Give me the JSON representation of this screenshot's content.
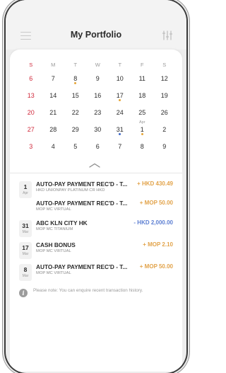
{
  "header": {
    "title": "My Portfolio",
    "menu_icon": "hamburger-menu-icon",
    "filter_icon": "filter-sliders-icon"
  },
  "calendar": {
    "weekdays": [
      "S",
      "M",
      "T",
      "W",
      "T",
      "F",
      "S"
    ],
    "weeks": [
      [
        {
          "d": "6"
        },
        {
          "d": "7"
        },
        {
          "d": "8",
          "dot": "orange"
        },
        {
          "d": "9"
        },
        {
          "d": "10"
        },
        {
          "d": "11"
        },
        {
          "d": "12"
        }
      ],
      [
        {
          "d": "13"
        },
        {
          "d": "14"
        },
        {
          "d": "15"
        },
        {
          "d": "16"
        },
        {
          "d": "17",
          "dot": "orange"
        },
        {
          "d": "18"
        },
        {
          "d": "19"
        }
      ],
      [
        {
          "d": "20"
        },
        {
          "d": "21"
        },
        {
          "d": "22"
        },
        {
          "d": "23"
        },
        {
          "d": "24"
        },
        {
          "d": "25"
        },
        {
          "d": "26"
        }
      ],
      [
        {
          "d": "27"
        },
        {
          "d": "28"
        },
        {
          "d": "29"
        },
        {
          "d": "30"
        },
        {
          "d": "31",
          "dot": "blue"
        },
        {
          "d": "1",
          "month": "Apr",
          "dot": "orange"
        },
        {
          "d": "2"
        }
      ],
      [
        {
          "d": "3"
        },
        {
          "d": "4"
        },
        {
          "d": "5"
        },
        {
          "d": "6"
        },
        {
          "d": "7"
        },
        {
          "d": "8"
        },
        {
          "d": "9"
        }
      ]
    ],
    "collapse_icon": "chevron-up-icon"
  },
  "transactions": [
    {
      "day": "1",
      "month": "Apr",
      "title": "AUTO-PAY PAYMENT REC'D - T...",
      "sub": "HKD UNIONPAY PLATINUM CR HKD",
      "amount": "+ HKD 430.49",
      "type": "pos"
    },
    {
      "day": "",
      "month": "",
      "title": "AUTO-PAY PAYMENT REC'D - T...",
      "sub": "MOP MC VIRTUAL",
      "amount": "+ MOP 50.00",
      "type": "pos"
    },
    {
      "day": "31",
      "month": "Mar",
      "title": "ABC KLN CITY HK",
      "sub": "MOP MC TITANIUM",
      "amount": "- HKD 2,000.00",
      "type": "neg"
    },
    {
      "day": "17",
      "month": "Mar",
      "title": "CASH BONUS",
      "sub": "MOP MC VIRTUAL",
      "amount": "+ MOP 2.10",
      "type": "pos"
    },
    {
      "day": "8",
      "month": "Mar",
      "title": "AUTO-PAY PAYMENT REC'D - T...",
      "sub": "MOP MC VIRTUAL",
      "amount": "+ MOP 50.00",
      "type": "pos"
    }
  ],
  "note": {
    "icon": "info-icon",
    "text": "Please note: You can enquire recent transaction history."
  },
  "colors": {
    "sunday_red": "#d0293b",
    "credit_orange": "#e2a34a",
    "debit_blue": "#5d7fd2",
    "event_dot_orange": "#e6a63a",
    "event_dot_blue": "#3f68c8"
  }
}
